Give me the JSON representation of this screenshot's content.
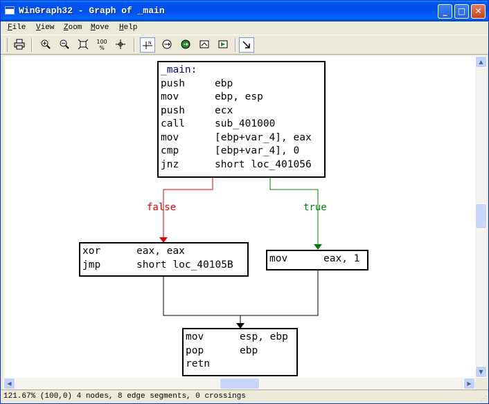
{
  "window": {
    "title": "WinGraph32 - Graph of _main",
    "minimize": "_",
    "maximize": "□",
    "close": "✕"
  },
  "menu": [
    {
      "u": "F",
      "rest": "ile"
    },
    {
      "u": "V",
      "rest": "iew"
    },
    {
      "u": "Z",
      "rest": "oom"
    },
    {
      "u": "M",
      "rest": "ove"
    },
    {
      "u": "H",
      "rest": "elp"
    }
  ],
  "toolbar": {
    "icons": [
      "print-icon",
      "zoom-in-icon",
      "zoom-out-icon",
      "fit-window-icon",
      "zoom-100-icon",
      "center-icon",
      "layout-icon",
      "smart-move-icon",
      "goto-node-icon",
      "rotate-icon",
      "next-node-icon",
      "follow-edge-icon"
    ],
    "zoom100_label": "100"
  },
  "graph": {
    "main_label": "_main:",
    "nodes": [
      {
        "id": "entry",
        "rows": [
          [
            "push",
            "ebp"
          ],
          [
            "mov",
            "ebp, esp"
          ],
          [
            "push",
            "ecx"
          ],
          [
            "call",
            "sub_401000"
          ],
          [
            "mov",
            "[ebp+var_4], eax"
          ],
          [
            "cmp",
            "[ebp+var_4], 0"
          ],
          [
            "jnz",
            "short loc_401056"
          ]
        ]
      },
      {
        "id": "false-branch",
        "rows": [
          [
            "xor",
            "eax, eax"
          ],
          [
            "jmp",
            "short loc_40105B"
          ]
        ]
      },
      {
        "id": "true-branch",
        "rows": [
          [
            "mov",
            "eax, 1"
          ]
        ]
      },
      {
        "id": "exit",
        "rows": [
          [
            "mov",
            "esp, ebp"
          ],
          [
            "pop",
            "ebp"
          ],
          [
            "retn",
            ""
          ]
        ]
      }
    ],
    "edge_labels": {
      "false": "false",
      "true": "true"
    },
    "colors": {
      "false_edge": "#e00000",
      "true_edge": "#008000",
      "normal_edge": "#000000",
      "label": "#00008b"
    }
  },
  "status": {
    "text": "121.67% (100,0) 4 nodes, 8 edge segments, 0 crossings"
  }
}
